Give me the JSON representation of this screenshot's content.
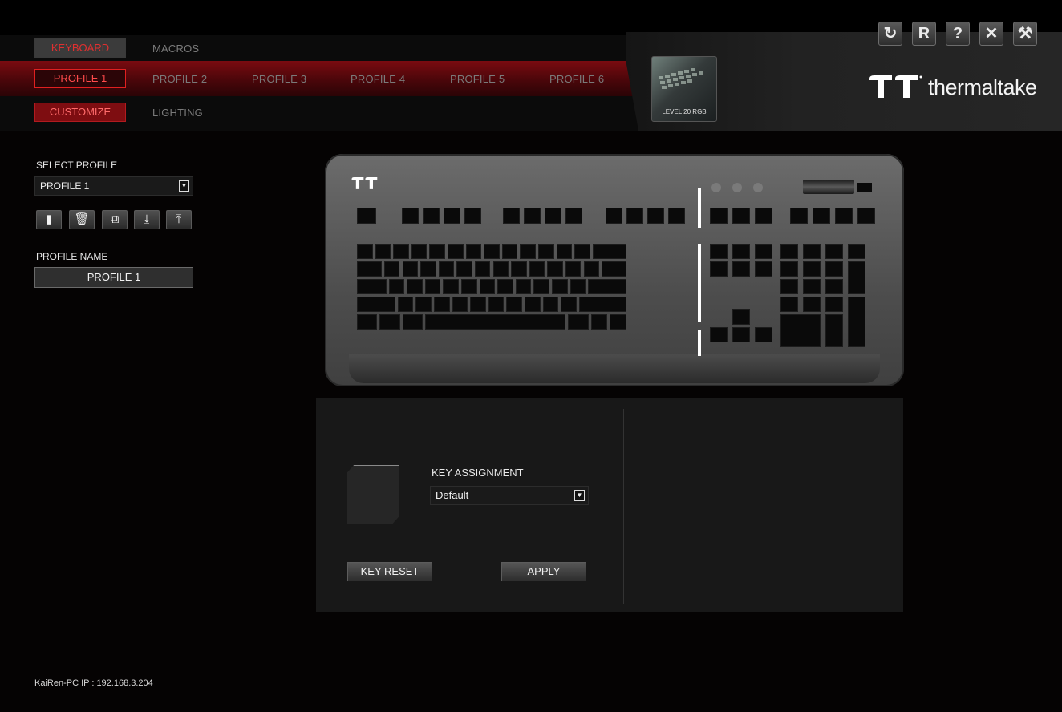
{
  "nav": {
    "top_tabs": [
      "KEYBOARD",
      "MACROS"
    ],
    "profile_tabs": [
      "PROFILE 1",
      "PROFILE 2",
      "PROFILE 3",
      "PROFILE 4",
      "PROFILE 5",
      "PROFILE 6"
    ],
    "sub_tabs": [
      "CUSTOMIZE",
      "LIGHTING"
    ]
  },
  "device": {
    "name": "LEVEL 20 RGB"
  },
  "brand": {
    "name": "thermaltake"
  },
  "window_controls": [
    "refresh-icon",
    "r-icon",
    "help-icon",
    "close-icon",
    "tools-icon"
  ],
  "profile_pane": {
    "select_label": "SELECT PROFILE",
    "selected_profile": "PROFILE 1",
    "profile_name_label": "PROFILE NAME",
    "profile_name_value": "PROFILE 1",
    "action_icons": [
      "new-profile-icon",
      "delete-icon",
      "copy-icon",
      "import-icon",
      "export-icon"
    ]
  },
  "assignment": {
    "label": "KEY ASSIGNMENT",
    "selected": "Default",
    "reset_label": "KEY RESET",
    "apply_label": "APPLY"
  },
  "status": {
    "ip_text": "KaiRen-PC IP : 192.168.3.204"
  },
  "colors": {
    "accent": "#e02020",
    "panel": "#181818",
    "background": "#050303"
  }
}
